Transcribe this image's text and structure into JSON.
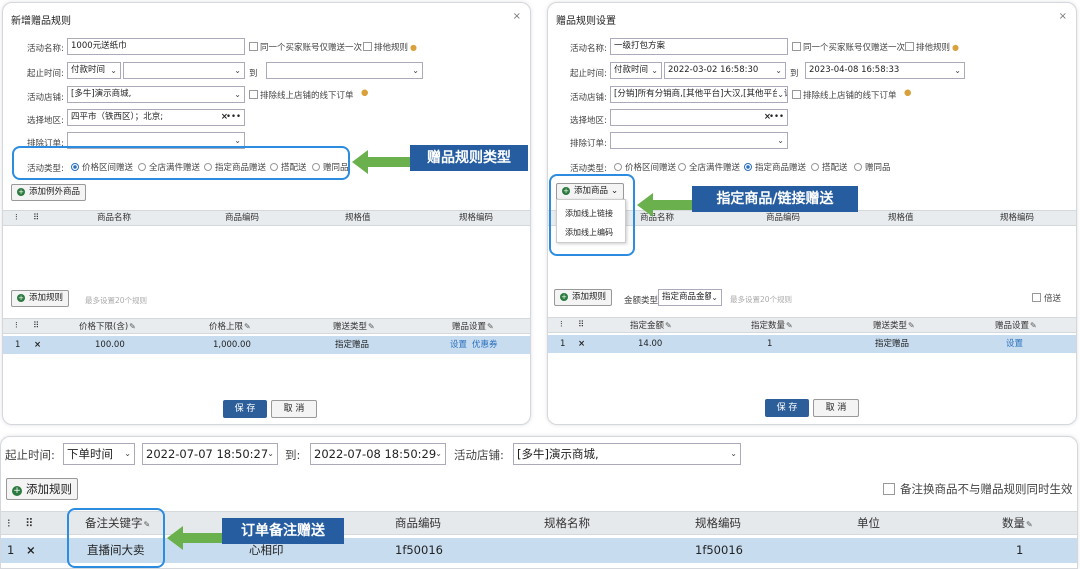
{
  "panel1": {
    "title": "新增赠品规则",
    "close": "×",
    "activity_name_label": "活动名称:",
    "activity_name_value": "1000元送纸巾",
    "once_check_label": "同一个买家账号仅赠送一次",
    "exclusive_label": "排他规则",
    "time_label": "起止时间:",
    "time_type": "付款时间",
    "time_start": "",
    "to_label": "到",
    "time_end": "",
    "shop_label": "活动店铺:",
    "shop_value": "[多牛]演示商城,",
    "exclude_offline_label": "排除线上店铺的线下订单",
    "region_label": "选择地区:",
    "region_value": "四平市（铁西区）；北京;",
    "exclude_order_label": "排除订单:",
    "exclude_order_value": "",
    "type_label": "活动类型:",
    "types": [
      "价格区间赠送",
      "全店满件赠送",
      "指定商品赠送",
      "搭配送",
      "赠同品"
    ],
    "add_exception_btn": "添加例外商品",
    "goods_headers": [
      "商品名称",
      "商品编码",
      "规格值",
      "规格编码"
    ],
    "add_rule_btn": "添加规则",
    "rule_hint": "最多设置20个规则",
    "rule_headers": [
      "价格下限(含)",
      "价格上限",
      "赠送类型",
      "赠品设置"
    ],
    "rule_row": {
      "index": "1",
      "del": "×",
      "low": "100.00",
      "high": "1,000.00",
      "type": "指定赠品",
      "set": "设置",
      "coupon": "优惠券"
    },
    "save_btn": "保 存",
    "cancel_btn": "取 消"
  },
  "panel2": {
    "title": "赠品规则设置",
    "close": "×",
    "activity_name_label": "活动名称:",
    "activity_name_value": "一级打包方案",
    "once_check_label": "同一个买家账号仅赠送一次",
    "exclusive_label": "排他规则",
    "time_label": "起止时间:",
    "time_type": "付款时间",
    "time_start": "2022-03-02 16:58:30",
    "to_label": "到",
    "time_end": "2023-04-08 16:58:33",
    "shop_label": "活动店铺:",
    "shop_value": "[分销]所有分销商,[其他平台]大汉,[其他平台]订",
    "exclude_offline_label": "排除线上店铺的线下订单",
    "region_label": "选择地区:",
    "region_value": "",
    "exclude_order_label": "排除订单:",
    "type_label": "活动类型:",
    "types": [
      "价格区间赠送",
      "全店满件赠送",
      "指定商品赠送",
      "搭配送",
      "赠同品"
    ],
    "add_goods_btn": "添加商品",
    "menu_items": [
      "添加线上链接",
      "添加线上编码"
    ],
    "goods_headers": [
      "商品名称",
      "商品编码",
      "规格值",
      "规格编码"
    ],
    "add_rule_btn": "添加规则",
    "amount_type_label": "金额类型:",
    "amount_type_value": "指定商品金额",
    "rule_hint": "最多设置20个规则",
    "multiple_label": "倍送",
    "rule_headers": [
      "指定金额",
      "指定数量",
      "赠送类型",
      "赠品设置"
    ],
    "rule_row": {
      "index": "1",
      "del": "×",
      "amount": "14.00",
      "qty": "1",
      "type": "指定赠品",
      "set": "设置"
    },
    "save_btn": "保 存",
    "cancel_btn": "取 消"
  },
  "panel3": {
    "time_label": "起止时间:",
    "time_type": "下单时间",
    "time_start": "2022-07-07 18:50:27",
    "to_label": "到:",
    "time_end": "2022-07-08 18:50:29",
    "shop_label": "活动店铺:",
    "shop_value": "[多牛]演示商城,",
    "add_rule_btn": "添加规则",
    "remark_check_label": "备注换商品不与赠品规则同时生效",
    "headers": [
      "备注关键字",
      "商品编码",
      "规格名称",
      "规格编码",
      "单位",
      "数量"
    ],
    "row": {
      "index": "1",
      "del": "×",
      "keyword": "直播间大卖",
      "name": "心相印",
      "code": "1f50016",
      "spec": "",
      "spec_code": "1f50016",
      "unit": "",
      "qty": "1"
    }
  },
  "callouts": {
    "rule_type": "赠品规则类型",
    "specified_goods": "指定商品/链接赠送",
    "order_remark": "订单备注赠送"
  },
  "colors": {
    "highlight": "#2b8ce0",
    "callout_bg": "#255da0",
    "arrow": "#6ab04c",
    "primary_btn": "#2c5e99",
    "row_selected": "#c7dcef"
  },
  "icons": {
    "pencil": "✎",
    "info": "❷",
    "dots": "•••",
    "arrow_down": "⌄"
  }
}
